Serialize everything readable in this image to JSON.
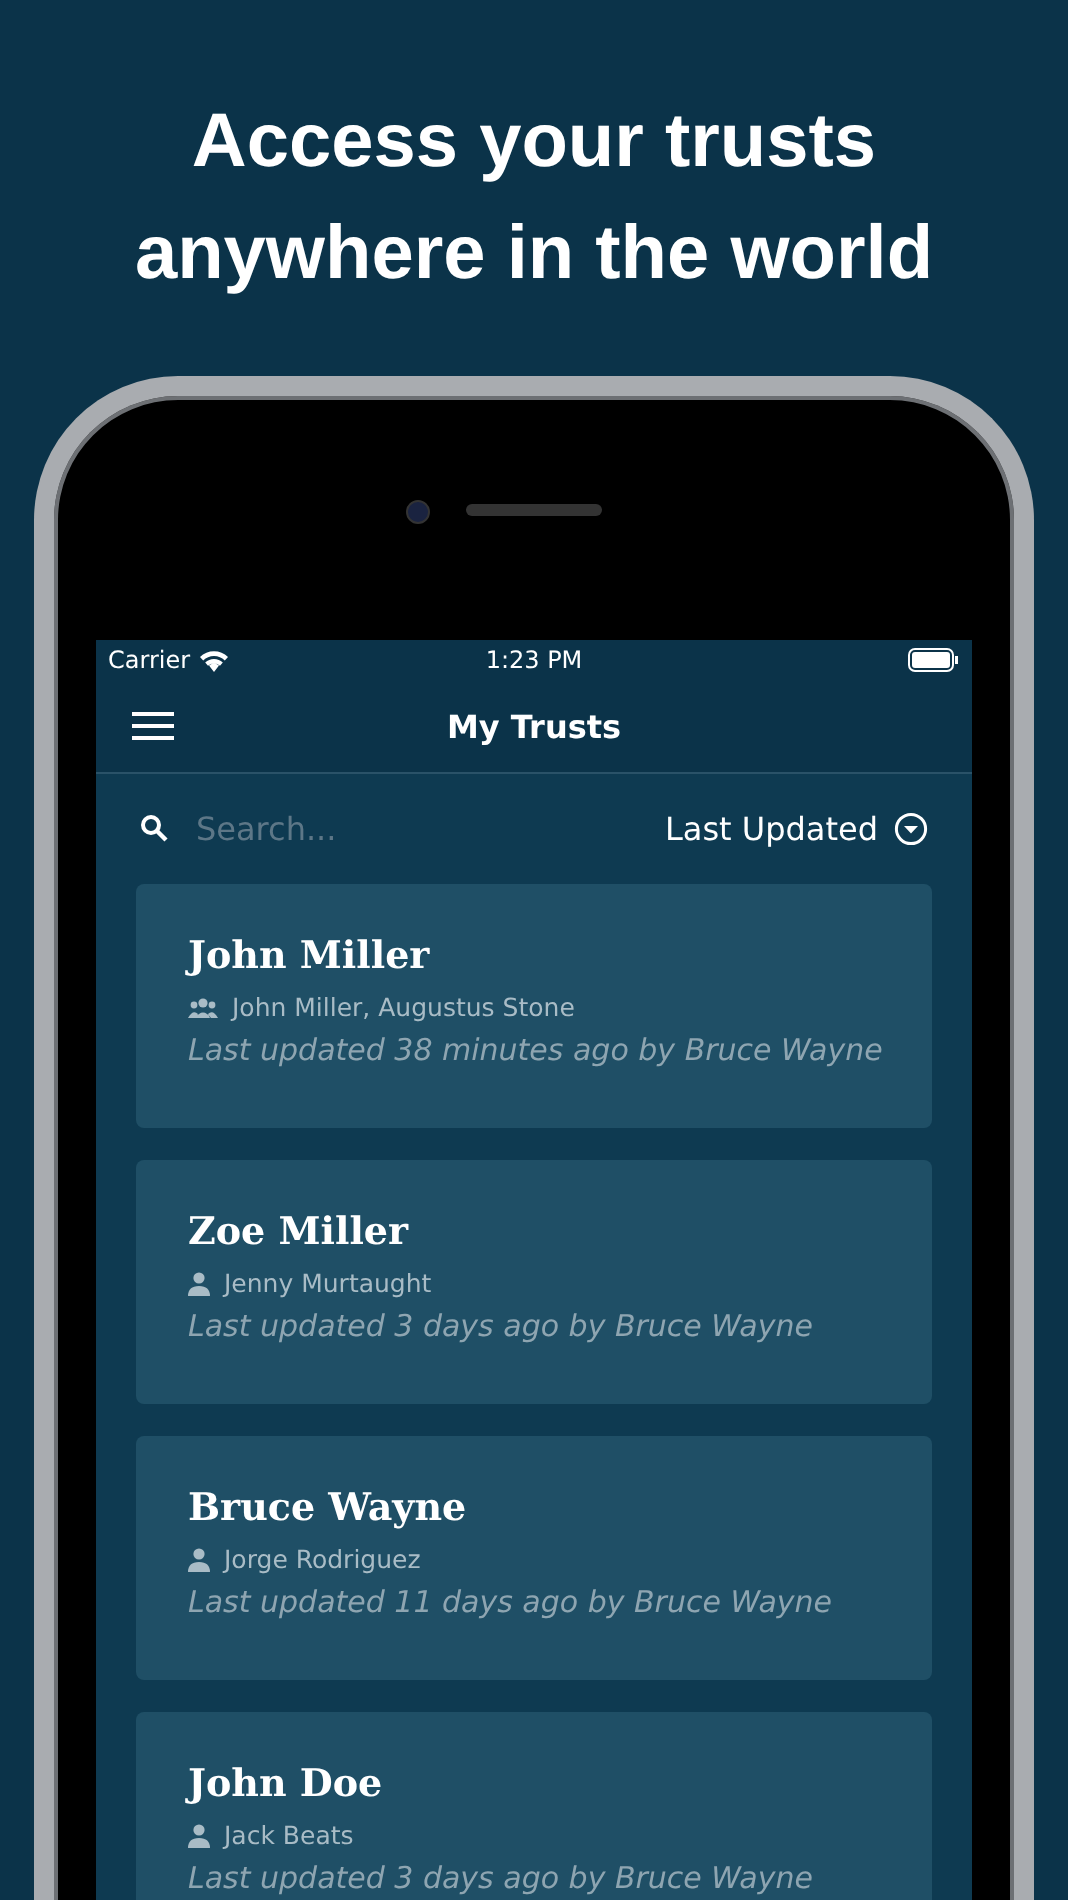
{
  "headline": "Access your trusts anywhere in the world",
  "status_bar": {
    "carrier": "Carrier",
    "time": "1:23 PM"
  },
  "nav": {
    "title": "My Trusts"
  },
  "search": {
    "placeholder": "Search..."
  },
  "sort": {
    "label": "Last Updated"
  },
  "trusts": [
    {
      "name": "John Miller",
      "kind": "group",
      "members": "John Miller, Augustus Stone",
      "updated": "Last updated 38 minutes ago by Bruce Wayne"
    },
    {
      "name": "Zoe Miller",
      "kind": "person",
      "members": "Jenny Murtaught",
      "updated": "Last updated 3 days ago by Bruce Wayne"
    },
    {
      "name": "Bruce Wayne",
      "kind": "person",
      "members": "Jorge Rodriguez",
      "updated": "Last updated 11 days ago by Bruce Wayne"
    },
    {
      "name": "John Doe",
      "kind": "person",
      "members": "Jack Beats",
      "updated": "Last updated 3 days ago by Bruce Wayne"
    }
  ]
}
